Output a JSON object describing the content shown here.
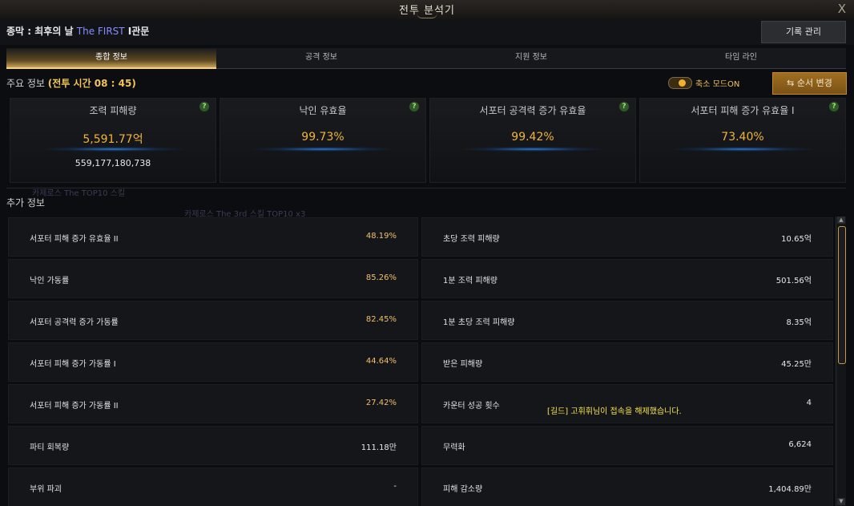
{
  "window": {
    "title": "전투 분석기",
    "close": "X"
  },
  "header": {
    "zone_prefix": "종막 : 최후의 날 ",
    "zone_highlight": "The FIRST",
    "zone_suffix": " I관문",
    "record_button": "기록 관리"
  },
  "tabs": [
    {
      "label": "종합 정보",
      "active": true
    },
    {
      "label": "공격 정보",
      "active": false
    },
    {
      "label": "지원 정보",
      "active": false
    },
    {
      "label": "타임 라인",
      "active": false
    }
  ],
  "main": {
    "label": "주요 정보 ",
    "battle_time": "(전투 시간 08 : 45)",
    "toggle_label": "축소 모드ON",
    "order_button": "순서 변경"
  },
  "cards": [
    {
      "title": "조력 피해량",
      "value": "5,591.77억",
      "sub": "559,177,180,738"
    },
    {
      "title": "낙인 유효율",
      "value": "99.73%",
      "sub": ""
    },
    {
      "title": "서포터 공격력 증가 유효율",
      "value": "99.42%",
      "sub": ""
    },
    {
      "title": "서포터 피해 증가 유효율 I",
      "value": "73.40%",
      "sub": ""
    }
  ],
  "extra": {
    "label": "추가 정보",
    "ghost1": "카제로스 The TOP10 스킬",
    "ghost2": "카제로스 The 3rd 스킬 TOP10 x3"
  },
  "rows_left": [
    {
      "label": "서포터 피해 증가 유효율 II",
      "value": "48.19%"
    },
    {
      "label": "낙인 가동률",
      "value": "85.26%"
    },
    {
      "label": "서포터 공격력 증가 가동률",
      "value": "82.45%"
    },
    {
      "label": "서포터 피해 증가 가동률 I",
      "value": "44.64%"
    },
    {
      "label": "서포터 피해 증가 가동률 II",
      "value": "27.42%"
    },
    {
      "label": "파티 회복량",
      "value": "111.18만"
    },
    {
      "label": "부위 파괴",
      "value": "-"
    }
  ],
  "rows_right": [
    {
      "label": "초당 조력 피해량",
      "value": "10.65억"
    },
    {
      "label": "1분 조력 피해량",
      "value": "501.56억"
    },
    {
      "label": "1분 초당 조력 피해량",
      "value": "8.35억"
    },
    {
      "label": "받은 피해량",
      "value": "45.25만"
    },
    {
      "label": "카운터 성공 횟수",
      "value": "4"
    },
    {
      "label": "무력화",
      "value": "6,624"
    },
    {
      "label": "피해 감소량",
      "value": "1,404.89만"
    }
  ],
  "notice": "[길드] 고휘휘님이 접속을 해제했습니다.",
  "colors": {
    "accent_gold": "#f2b53a",
    "highlight_blue": "#8b8bff",
    "notice_yellow": "#f2e24a"
  }
}
